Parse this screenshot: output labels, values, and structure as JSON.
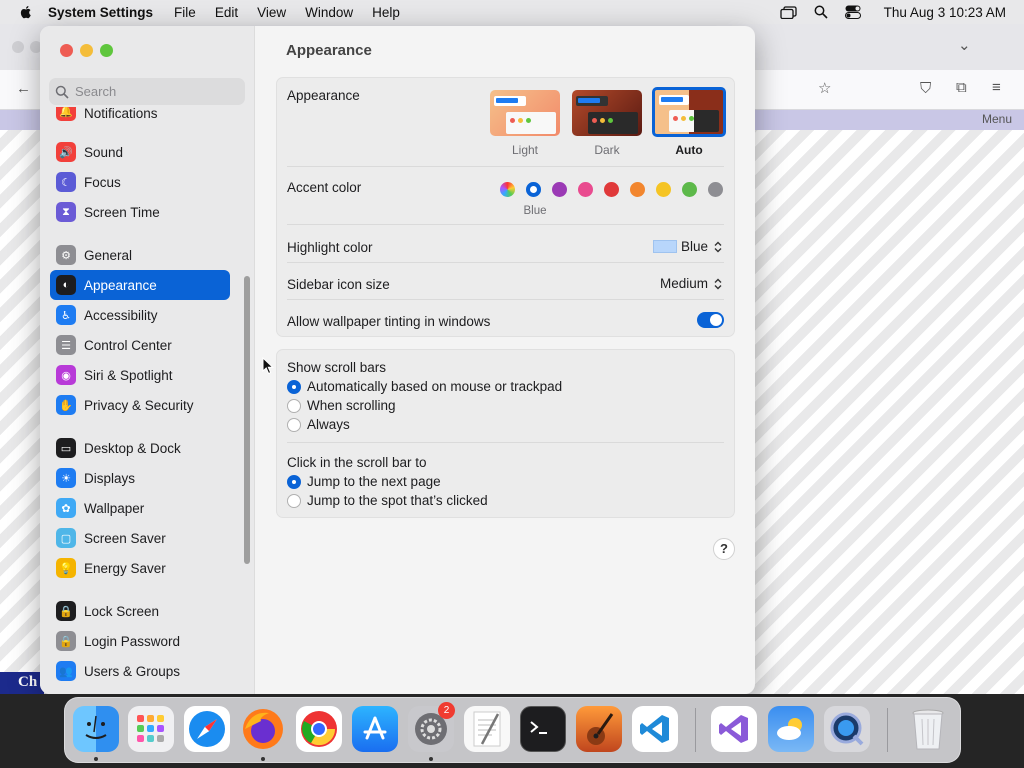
{
  "menubar": {
    "app_name": "System Settings",
    "items": [
      "File",
      "Edit",
      "View",
      "Window",
      "Help"
    ],
    "clock": "Thu Aug 3  10:23 AM"
  },
  "background_window": {
    "menu_label": "Menu",
    "chip_label": "Ch"
  },
  "search": {
    "placeholder": "Search"
  },
  "sidebar": {
    "items": [
      {
        "label": "Notifications",
        "icon": "bell-icon",
        "color": "#f2403b"
      },
      {
        "label": "Sound",
        "icon": "speaker-icon",
        "color": "#f2403b"
      },
      {
        "label": "Focus",
        "icon": "moon-icon",
        "color": "#5b5bd6"
      },
      {
        "label": "Screen Time",
        "icon": "hourglass-icon",
        "color": "#6b5bd6"
      },
      {
        "label": "General",
        "icon": "gear-icon",
        "color": "#8e8e93"
      },
      {
        "label": "Appearance",
        "icon": "appearance-icon",
        "color": "#1d1d1f"
      },
      {
        "label": "Accessibility",
        "icon": "accessibility-icon",
        "color": "#1e7cf2"
      },
      {
        "label": "Control Center",
        "icon": "control-center-icon",
        "color": "#8e8e93"
      },
      {
        "label": "Siri & Spotlight",
        "icon": "siri-icon",
        "color": "#b83ad8"
      },
      {
        "label": "Privacy & Security",
        "icon": "hand-icon",
        "color": "#1e7cf2"
      },
      {
        "label": "Desktop & Dock",
        "icon": "dock-icon",
        "color": "#1d1d1f"
      },
      {
        "label": "Displays",
        "icon": "sun-icon",
        "color": "#1e7cf2"
      },
      {
        "label": "Wallpaper",
        "icon": "flower-icon",
        "color": "#3fa9f5"
      },
      {
        "label": "Screen Saver",
        "icon": "screensaver-icon",
        "color": "#4fb6e8"
      },
      {
        "label": "Energy Saver",
        "icon": "bulb-icon",
        "color": "#f5b400"
      },
      {
        "label": "Lock Screen",
        "icon": "lock-icon",
        "color": "#1d1d1f"
      },
      {
        "label": "Login Password",
        "icon": "lock-icon",
        "color": "#8e8e93"
      },
      {
        "label": "Users & Groups",
        "icon": "users-icon",
        "color": "#1e7cf2"
      }
    ],
    "selected": "Appearance"
  },
  "main": {
    "title": "Appearance",
    "appearance": {
      "label": "Appearance",
      "options": [
        "Light",
        "Dark",
        "Auto"
      ],
      "selected": "Auto"
    },
    "accent": {
      "label": "Accent color",
      "selected_name": "Blue",
      "colors": [
        "#b06bd8",
        "#0a63d6",
        "#9b3ab5",
        "#e94b8f",
        "#e0393a",
        "#f2862e",
        "#f5c424",
        "#5db94a",
        "#8e8e93"
      ]
    },
    "highlight": {
      "label": "Highlight color",
      "value": "Blue",
      "swatch": "#b8d6fb"
    },
    "sidebar_icon_size": {
      "label": "Sidebar icon size",
      "value": "Medium"
    },
    "wallpaper_tint": {
      "label": "Allow wallpaper tinting in windows",
      "enabled": true
    },
    "scroll_bars": {
      "label": "Show scroll bars",
      "options": [
        "Automatically based on mouse or trackpad",
        "When scrolling",
        "Always"
      ],
      "selected": "Automatically based on mouse or trackpad"
    },
    "click_scroll": {
      "label": "Click in the scroll bar to",
      "options": [
        "Jump to the next page",
        "Jump to the spot that’s clicked"
      ],
      "selected": "Jump to the next page"
    },
    "help": "?"
  },
  "dock": {
    "apps": [
      "Finder",
      "Launchpad",
      "Safari",
      "Firefox",
      "Chrome",
      "App Store",
      "System Settings",
      "TextEdit",
      "Terminal",
      "GarageBand",
      "Visual Studio Code",
      "Visual Studio",
      "Weather",
      "QuickTime",
      "Trash"
    ],
    "settings_badge": "2"
  }
}
